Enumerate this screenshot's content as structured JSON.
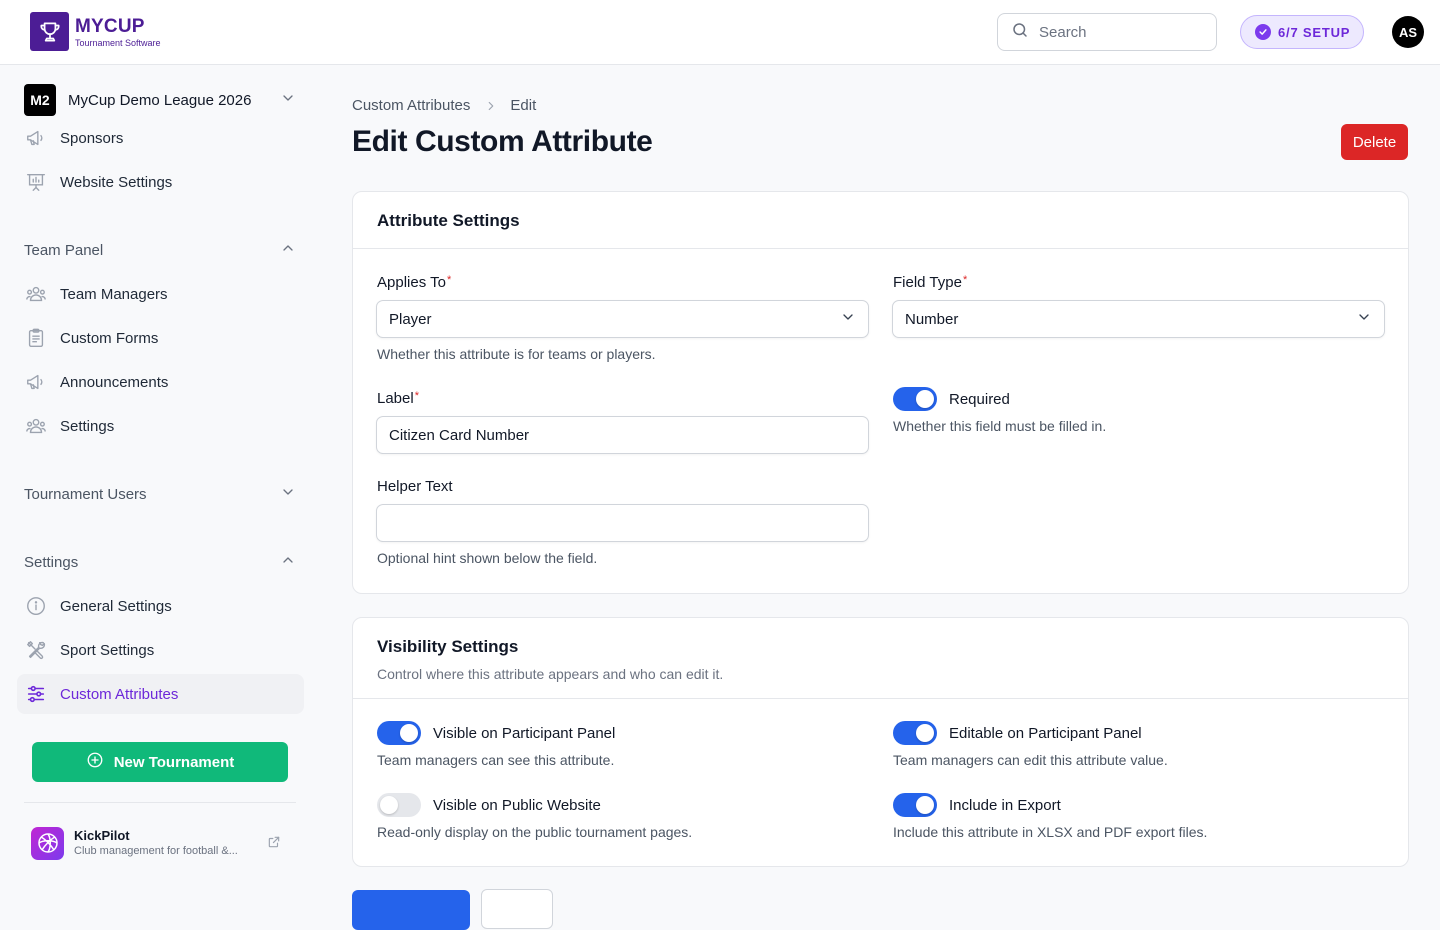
{
  "header": {
    "logo_name": "MYCUP",
    "logo_sub": "Tournament Software",
    "search_placeholder": "Search",
    "setup_label": "6/7 SETUP",
    "avatar_initials": "AS"
  },
  "sidebar": {
    "league_badge": "M2",
    "league_name": "MyCup Demo League 2026",
    "top_items": [
      {
        "label": "Sponsors",
        "icon": "megaphone-icon"
      },
      {
        "label": "Website Settings",
        "icon": "presentation-icon"
      }
    ],
    "team_panel": {
      "label": "Team Panel",
      "items": [
        {
          "label": "Team Managers",
          "icon": "users-icon"
        },
        {
          "label": "Custom Forms",
          "icon": "clipboard-icon"
        },
        {
          "label": "Announcements",
          "icon": "megaphone-icon"
        },
        {
          "label": "Settings",
          "icon": "users-gear-icon"
        }
      ]
    },
    "tournament_users": {
      "label": "Tournament Users"
    },
    "settings": {
      "label": "Settings",
      "items": [
        {
          "label": "General Settings",
          "icon": "info-icon"
        },
        {
          "label": "Sport Settings",
          "icon": "tools-icon"
        },
        {
          "label": "Custom Attributes",
          "icon": "sliders-icon"
        }
      ]
    },
    "new_tournament_label": "New Tournament",
    "promo": {
      "name": "KickPilot",
      "description": "Club management for football &..."
    }
  },
  "main": {
    "breadcrumb": [
      "Custom Attributes",
      "Edit"
    ],
    "title": "Edit Custom Attribute",
    "delete_label": "Delete",
    "attribute_settings": {
      "title": "Attribute Settings",
      "applies_to": {
        "label": "Applies To",
        "value": "Player",
        "help": "Whether this attribute is for teams or players."
      },
      "field_type": {
        "label": "Field Type",
        "value": "Number"
      },
      "label_field": {
        "label": "Label",
        "value": "Citizen Card Number"
      },
      "required": {
        "label": "Required",
        "help": "Whether this field must be filled in.",
        "on": true
      },
      "helper_text": {
        "label": "Helper Text",
        "value": "",
        "help": "Optional hint shown below the field."
      }
    },
    "visibility_settings": {
      "title": "Visibility Settings",
      "description": "Control where this attribute appears and who can edit it.",
      "toggles": [
        {
          "label": "Visible on Participant Panel",
          "help": "Team managers can see this attribute.",
          "on": true
        },
        {
          "label": "Editable on Participant Panel",
          "help": "Team managers can edit this attribute value.",
          "on": true
        },
        {
          "label": "Visible on Public Website",
          "help": "Read-only display on the public tournament pages.",
          "on": false
        },
        {
          "label": "Include in Export",
          "help": "Include this attribute in XLSX and PDF export files.",
          "on": true
        }
      ]
    }
  },
  "colors": {
    "brand": "#4c1d95",
    "accent": "#6d28d9",
    "primary": "#2563eb",
    "danger": "#dc2626",
    "success": "#10b97a"
  }
}
